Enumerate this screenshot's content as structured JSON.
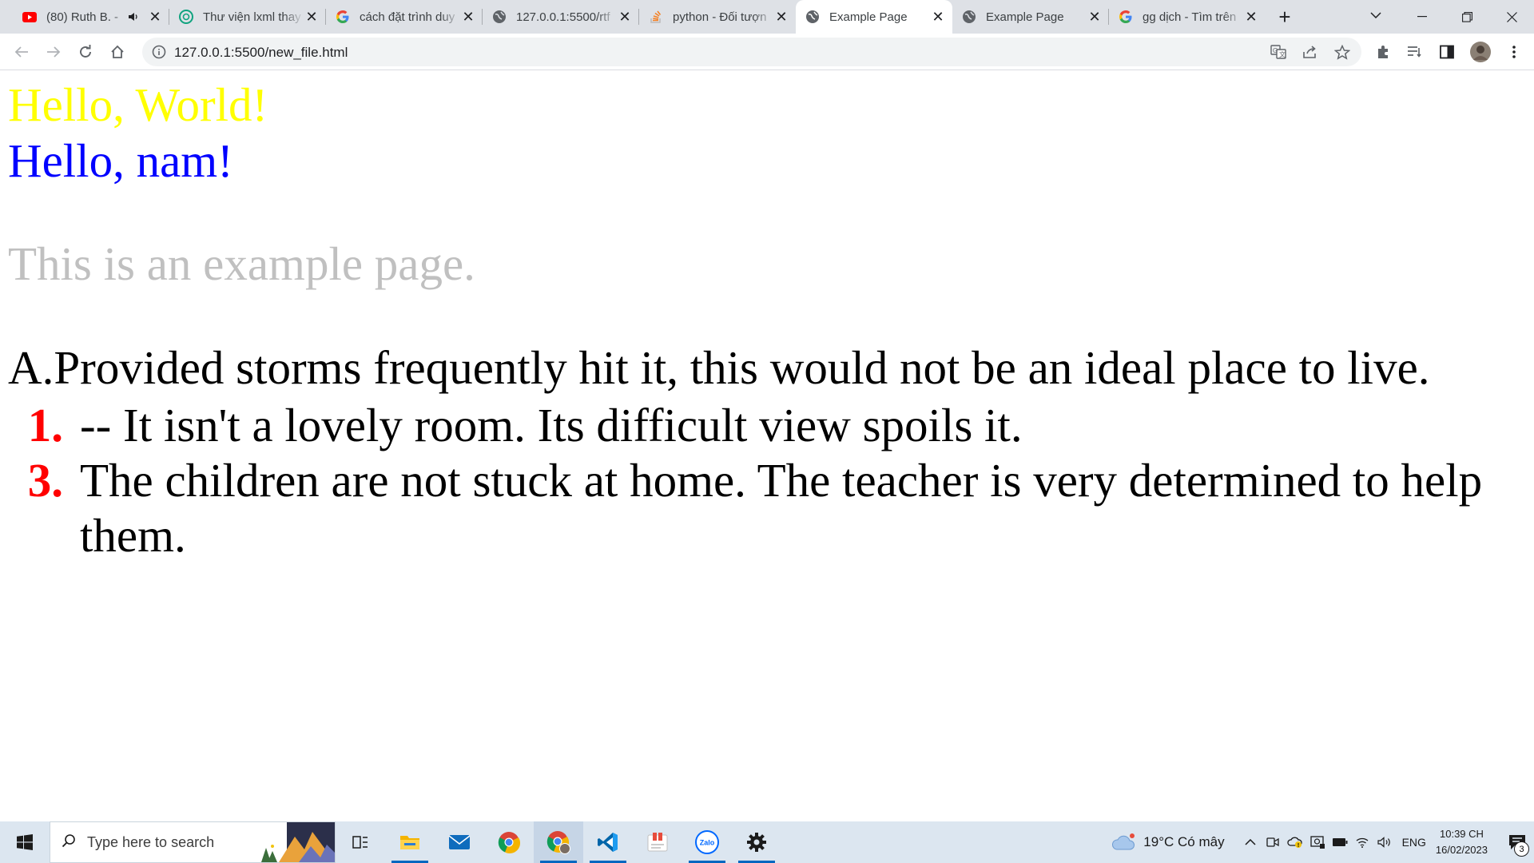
{
  "browser": {
    "tabs": [
      {
        "title": "(80) Ruth B. -",
        "favicon": "youtube-icon",
        "audio": true
      },
      {
        "title": "Thư viện lxml thay",
        "favicon": "chatgpt-icon"
      },
      {
        "title": "cách đặt trình duy",
        "favicon": "google-icon"
      },
      {
        "title": "127.0.0.1:5500/rtf",
        "favicon": "globe-icon"
      },
      {
        "title": "python - Đối tượn",
        "favicon": "stackoverflow-icon"
      },
      {
        "title": "Example Page",
        "favicon": "globe-icon",
        "active": true
      },
      {
        "title": "Example Page",
        "favicon": "globe-icon"
      },
      {
        "title": "gg dịch - Tìm trên",
        "favicon": "google-icon"
      }
    ],
    "url": "127.0.0.1:5500/new_file.html"
  },
  "page": {
    "heading_yellow": "Hello, World!",
    "heading_blue": "Hello, nam!",
    "paragraph_gray": "This is an example page.",
    "paragraph_main": "A.Provided storms frequently hit it, this would not be an ideal place to live.",
    "list": [
      {
        "number": "1.",
        "text": "-- It isn't a lovely room. Its difficult view spoils it."
      },
      {
        "number": "3.",
        "text": "The children are not stuck at home. The teacher is very determined to help them."
      }
    ]
  },
  "taskbar": {
    "search_placeholder": "Type here to search",
    "weather": "19°C  Có mây",
    "language": "ENG",
    "time": "10:39 CH",
    "date": "16/02/2023",
    "notification_count": "3",
    "apps": [
      "task-view-icon",
      "file-explorer-icon",
      "mail-icon",
      "chrome-icon",
      "chrome-profile-icon",
      "vscode-icon",
      "snipping-tool-icon",
      "zalo-icon",
      "settings-icon"
    ]
  },
  "colors": {
    "heading_yellow": "#ffff00",
    "heading_blue": "#0000ff",
    "paragraph_gray": "#c0c0c0",
    "list_number": "#ff0000"
  }
}
